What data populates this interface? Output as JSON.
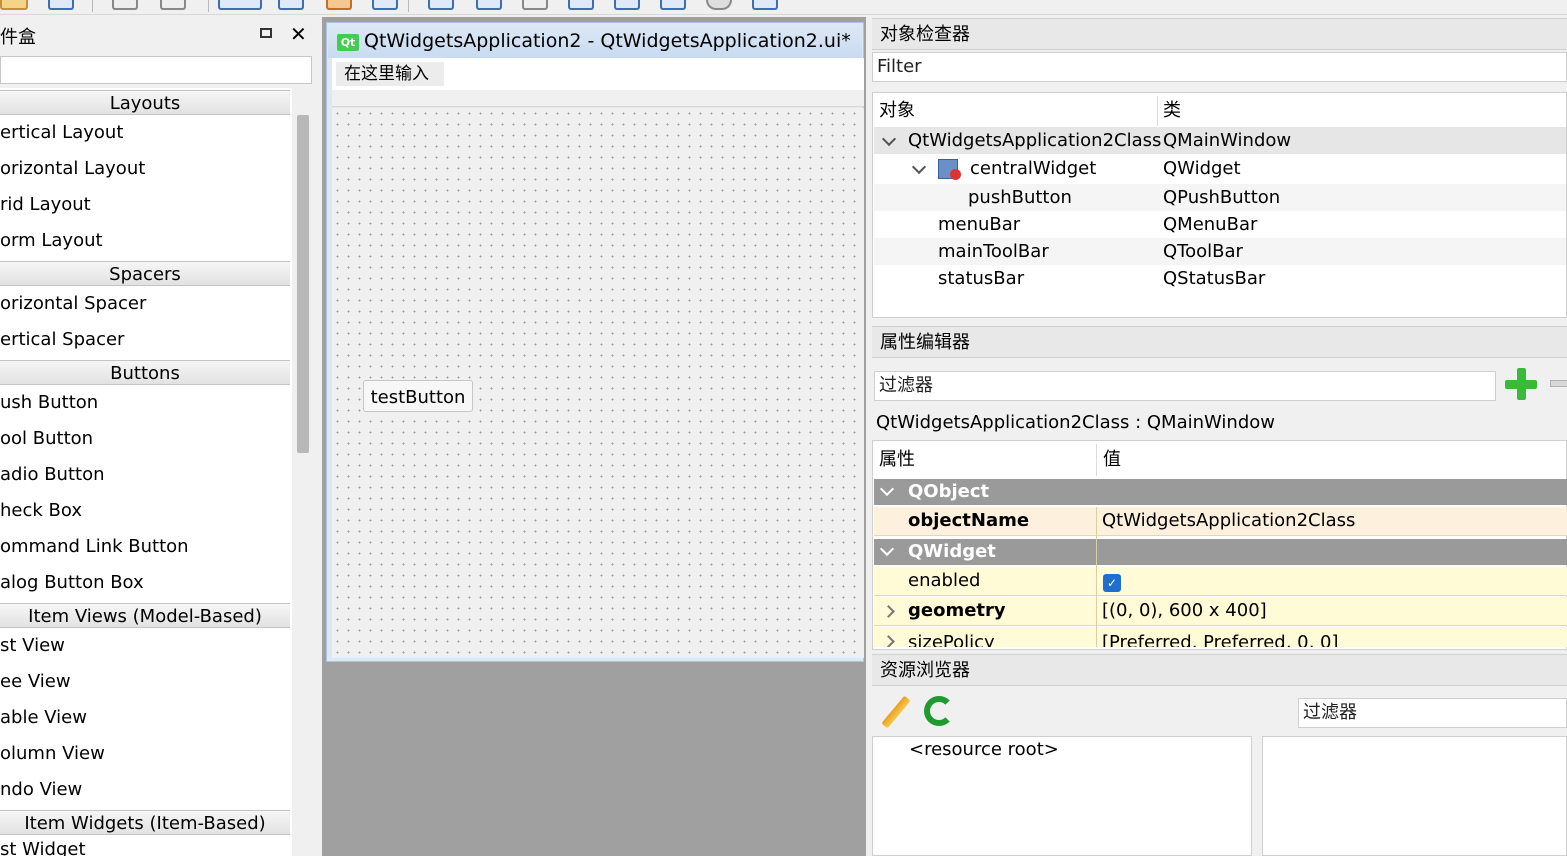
{
  "widget_box": {
    "title": "件盒",
    "categories": [
      {
        "label": "Layouts",
        "items": [
          "ertical Layout",
          "orizontal Layout",
          "rid Layout",
          "orm Layout"
        ]
      },
      {
        "label": "Spacers",
        "items": [
          "orizontal Spacer",
          "ertical Spacer"
        ]
      },
      {
        "label": "Buttons",
        "items": [
          "ush Button",
          "ool Button",
          "adio Button",
          "heck Box",
          "ommand Link Button",
          "alog Button Box"
        ]
      },
      {
        "label": "Item Views (Model-Based)",
        "items": [
          "st View",
          "ee View",
          "able View",
          "olumn View",
          "ndo View"
        ]
      },
      {
        "label": "Item Widgets (Item-Based)",
        "items": [
          "st Widget"
        ]
      }
    ],
    "float_icon": "restore-icon",
    "close_icon": "close-icon"
  },
  "form": {
    "logo_text": "Qt",
    "title": "QtWidgetsApplication2 - QtWidgetsApplication2.ui*",
    "menu_placeholder": "在这里输入",
    "button_label": "testButton"
  },
  "object_inspector": {
    "title": "对象检查器",
    "filter_placeholder": "Filter",
    "col_object": "对象",
    "col_class": "类",
    "rows": [
      {
        "name": "QtWidgetsApplication2Class",
        "cls": "QMainWindow"
      },
      {
        "name": "centralWidget",
        "cls": "QWidget"
      },
      {
        "name": "pushButton",
        "cls": "QPushButton"
      },
      {
        "name": "menuBar",
        "cls": "QMenuBar"
      },
      {
        "name": "mainToolBar",
        "cls": "QToolBar"
      },
      {
        "name": "statusBar",
        "cls": "QStatusBar"
      }
    ]
  },
  "property_editor": {
    "title": "属性编辑器",
    "filter_placeholder": "过滤器",
    "context": "QtWidgetsApplication2Class : QMainWindow",
    "col_property": "属性",
    "col_value": "值",
    "group_qobject": "QObject",
    "group_qwidget": "QWidget",
    "rows": [
      {
        "name": "objectName",
        "value": "QtWidgetsApplication2Class"
      },
      {
        "name": "enabled",
        "value": ""
      },
      {
        "name": "geometry",
        "value": "[(0, 0), 600 x 400]"
      },
      {
        "name": "sizePolicy",
        "value": "[Preferred, Preferred, 0, 0]"
      }
    ]
  },
  "resource_browser": {
    "title": "资源浏览器",
    "filter_placeholder": "过滤器",
    "root": "<resource root>"
  },
  "colors": {
    "accent": "#3a6fb0",
    "qt_green": "#41cd52",
    "group_header": "#9a9a9a",
    "property_bg": "#fffbd6",
    "object_name_bg": "#fdf0dc"
  }
}
